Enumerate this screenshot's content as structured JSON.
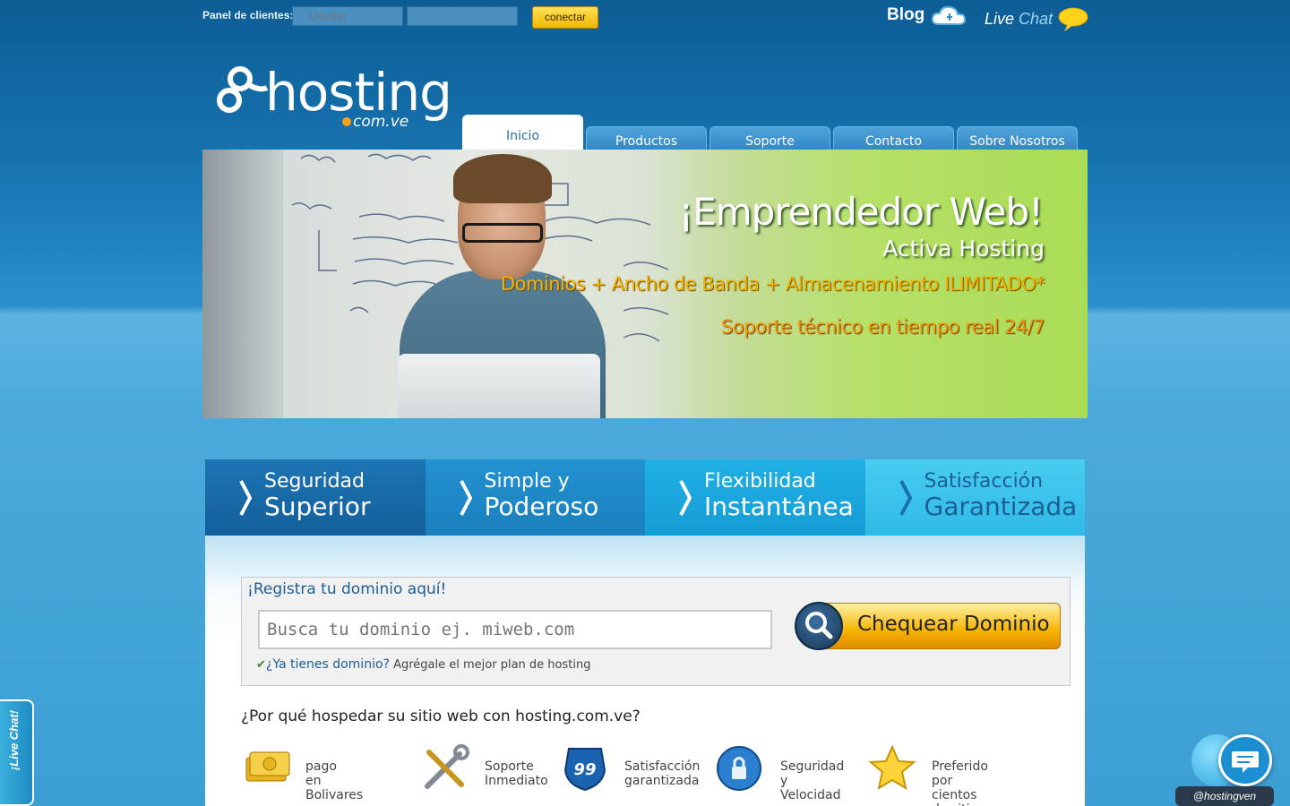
{
  "topbar": {
    "login_label": "Panel de clientes:",
    "username_placeholder": "Usuario",
    "password_placeholder": "",
    "connect_label": "conectar",
    "blog_label": "Blog",
    "live_label": "Live",
    "chat_label": "Chat"
  },
  "logo": {
    "name": "hosting",
    "domain": "com.ve"
  },
  "nav": {
    "tabs": [
      {
        "label": "Inicio",
        "active": true
      },
      {
        "label": "Productos"
      },
      {
        "label": "Soporte"
      },
      {
        "label": "Contacto"
      },
      {
        "label": "Sobre Nosotros"
      }
    ]
  },
  "hero": {
    "title": "¡Emprendedor Web!",
    "subtitle": "Activa Hosting",
    "line1": "Dominios + Ancho de Banda + Almacenamiento ILIMITADO*",
    "line2": "Soporte técnico en tiempo real 24/7"
  },
  "features": [
    {
      "line1": "Seguridad",
      "line2": "Superior",
      "color": "#1b6fae"
    },
    {
      "line1": "Simple y",
      "line2": "Poderoso",
      "color": "#1f8bc9"
    },
    {
      "line1": "Flexibilidad",
      "line2": "Instantánea",
      "color": "#19a6de"
    },
    {
      "line1": "Satisfacción",
      "line2": "Garantizada",
      "color": "#3fc1ea"
    }
  ],
  "domain": {
    "title": "¡Registra tu dominio aquí!",
    "input_placeholder": "Busca tu dominio ej. miweb.com",
    "have_domain_link": "¿Ya tienes dominio?",
    "have_domain_text": "Agrégale el mejor plan de hosting",
    "check_button": "Chequear Dominio"
  },
  "why": {
    "title": "¿Por qué hospedar su sitio web con hosting.com.ve?",
    "benefits": [
      {
        "line1": "pago",
        "line2": "en Bolivares",
        "icon": "money-icon"
      },
      {
        "line1": "Soporte",
        "line2": "Inmediato",
        "icon": "tools-icon"
      },
      {
        "line1": "Satisfacción",
        "line2": "garantizada",
        "icon": "badge-99-icon"
      },
      {
        "line1": "Seguridad y",
        "line2": "Velocidad",
        "icon": "lock-icon"
      },
      {
        "line1": "Preferido por",
        "line2": "cientos de sitios web",
        "icon": "star-icon"
      }
    ]
  },
  "side_chat": {
    "label": "¡Live Chat!"
  },
  "twitter": {
    "handle": "@hostingven"
  },
  "colors": {
    "accent_yellow": "#f7b400",
    "brand_blue": "#1d5e95"
  }
}
